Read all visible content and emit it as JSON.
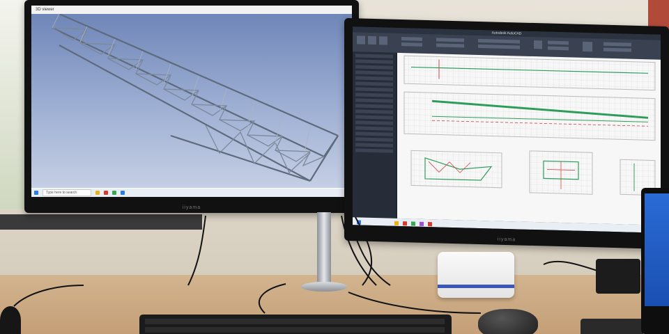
{
  "left_monitor": {
    "brand": "iiyama",
    "viewer_tab": "3D viewer",
    "taskbar_search": "Type here to search"
  },
  "right_monitor": {
    "brand": "iiyama",
    "app_title": "Autodesk AutoCAD",
    "taskbar_icon_colors": [
      "#2d7be5",
      "#e8b218",
      "#d43b2a",
      "#3aa655",
      "#9b4fd1"
    ]
  },
  "colors": {
    "model_sky": "#8ca0cc",
    "truss": "#5e6b7d",
    "cad_bg": "#1e2430",
    "cad_accent_green": "#2e9d5b",
    "cad_accent_red": "#c94545",
    "device_stripe": "#3a57b8"
  }
}
